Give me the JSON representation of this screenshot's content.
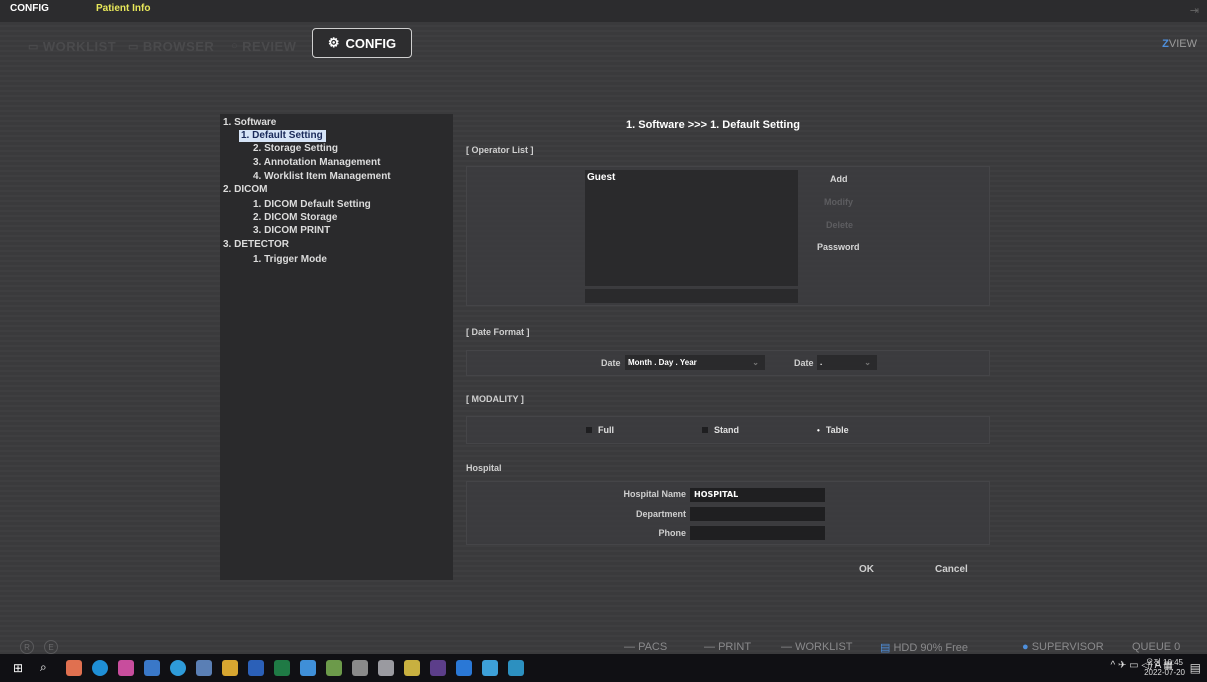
{
  "topbar": {
    "app_title": "CONFIG",
    "patient_info": "Patient Info",
    "exit_icon": "exit-icon"
  },
  "tabs": {
    "worklist": "WORKLIST",
    "browser": "BROWSER",
    "review": "REVIEW",
    "config": "CONFIG"
  },
  "logo": {
    "z": "Z",
    "rest": "VIEW"
  },
  "tree": {
    "software": "1. Software",
    "default_setting": "1. Default Setting",
    "storage_setting": "2. Storage Setting",
    "annotation_management": "3. Annotation Management",
    "worklist_item_management": "4. Worklist Item Management",
    "dicom": "2. DICOM",
    "dicom_default_setting": "1. DICOM Default Setting",
    "dicom_storage": "2. DICOM Storage",
    "dicom_print": "3. DICOM PRINT",
    "detector": "3. DETECTOR",
    "trigger_mode": "1. Trigger Mode"
  },
  "panel": {
    "heading": "1. Software >>> 1. Default Setting"
  },
  "operator": {
    "section_label": "[ Operator List ]",
    "items": [
      "Guest"
    ],
    "add": "Add",
    "modify": "Modify",
    "delete": "Delete",
    "password": "Password"
  },
  "date_format": {
    "section_label": "[ Date Format ]",
    "date_label": "Date",
    "date_value": "Month . Day . Year",
    "separator_label": "Date",
    "separator_value": "."
  },
  "modality": {
    "section_label": "[ MODALITY ]",
    "options": [
      "Full",
      "Stand",
      "Table"
    ],
    "selected": "Table"
  },
  "hospital": {
    "section_label": "Hospital",
    "name_label": "Hospital Name",
    "name_value": "HOSPITAL",
    "department_label": "Department",
    "department_value": "",
    "phone_label": "Phone",
    "phone_value": ""
  },
  "dialog": {
    "ok": "OK",
    "cancel": "Cancel"
  },
  "status": {
    "r": "R",
    "e": "E",
    "pacs": "PACS",
    "print": "PRINT",
    "worklist": "WORKLIST",
    "hdd": "HDD 90% Free",
    "user": "SUPERVISOR",
    "queue": "QUEUE  0"
  },
  "taskbar": {
    "ime_a": "A",
    "time": "오전 10:45",
    "date": "2022-07-20"
  },
  "colors": {
    "accent": "#4e8fdc",
    "patient_info": "#e8e85a",
    "selection": "#d6e4f7"
  }
}
